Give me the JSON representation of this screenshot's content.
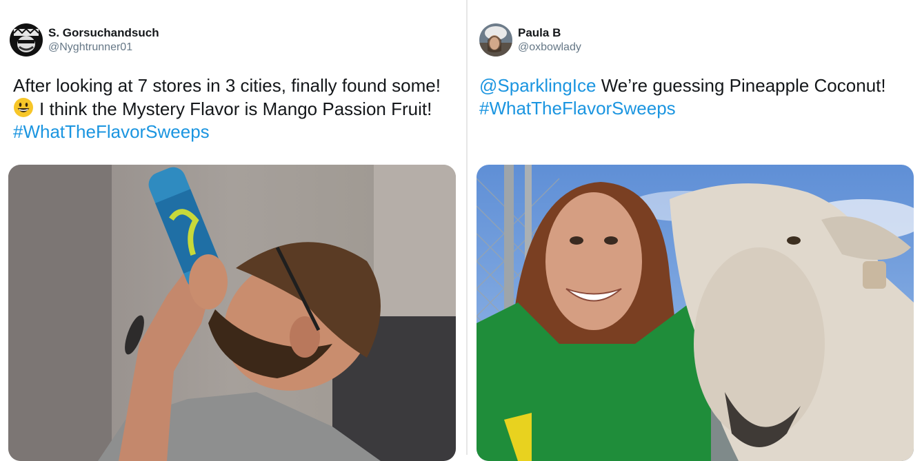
{
  "tweets": [
    {
      "author": {
        "name": "S. Gorsuchandsuch",
        "handle": "@Nyghtrunner01"
      },
      "text_line1": "After looking at 7 stores in 3 cities, finally found some!",
      "text_line2": "I think the Mystery Flavor is Mango Passion Fruit!",
      "hashtag": "#WhatTheFlavorSweeps",
      "emoji": "grinning-face-emoji",
      "photo": "man-drinking-sparkling-ice-bottle"
    },
    {
      "author": {
        "name": "Paula B",
        "handle": "@oxbowlady"
      },
      "mention": "@SparklingIce",
      "text_line1_rest": " We’re guessing Pineapple Coconut!",
      "hashtag": "#WhatTheFlavorSweeps",
      "photo": "woman-selfie-with-sheep"
    }
  ],
  "colors": {
    "link": "#1b95e0",
    "text": "#14171a",
    "secondary": "#657786",
    "divider": "#e6e6e6"
  }
}
